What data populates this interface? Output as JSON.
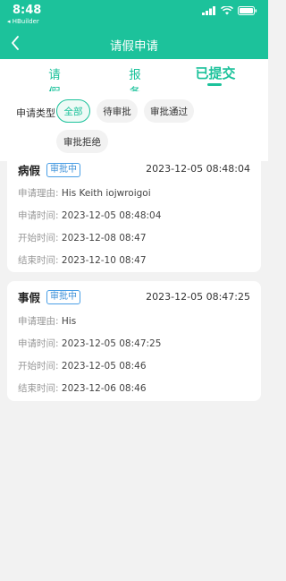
{
  "status_bar": {
    "time": "8:48",
    "back_app": "◂ HBuilder"
  },
  "header": {
    "title": "请假申请"
  },
  "tabs": [
    {
      "label": "请假"
    },
    {
      "label": "报备"
    },
    {
      "label": "已提交"
    }
  ],
  "filter": {
    "label": "申请类型",
    "options": [
      "全部",
      "待审批",
      "审批通过",
      "审批拒绝"
    ],
    "selected": "全部"
  },
  "field_labels": {
    "reason": "申请理由:",
    "apply_time": "申请时间:",
    "start_time": "开始时间:",
    "end_time": "结束时间:"
  },
  "records": [
    {
      "type": "病假",
      "status": "审批中",
      "date": "2023-12-05 08:48:04",
      "reason": "His Keith iojwroigoi",
      "apply_time": "2023-12-05 08:48:04",
      "start_time": "2023-12-08 08:47",
      "end_time": "2023-12-10 08:47"
    },
    {
      "type": "事假",
      "status": "审批中",
      "date": "2023-12-05 08:47:25",
      "reason": "His",
      "apply_time": "2023-12-05 08:47:25",
      "start_time": "2023-12-05 08:46",
      "end_time": "2023-12-06 08:46"
    }
  ],
  "colors": {
    "accent": "#1cc29b",
    "badge": "#3a8fd8"
  }
}
